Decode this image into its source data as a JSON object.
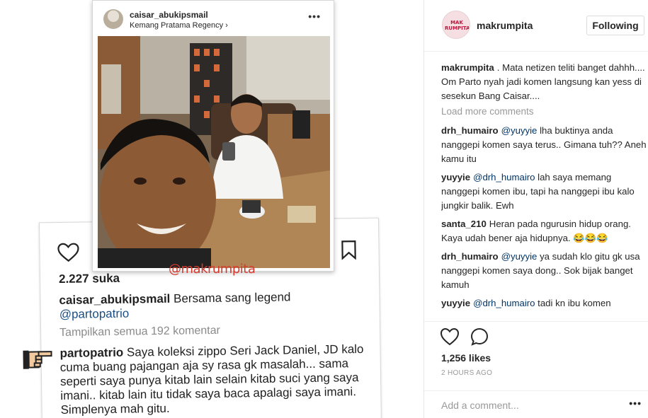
{
  "media": {
    "front": {
      "username": "caisar_abukipsmail",
      "location": "Kemang Pratama Regency",
      "more": "•••"
    },
    "watermark": "@makrumpita",
    "back": {
      "likes": "2.227 suka",
      "caption_user": "caisar_abukipsmail",
      "caption_text": "Bersama sang legend",
      "caption_mention": "@partopatrio",
      "view_all": "Tampilkan semua 192 komentar",
      "comment_user": "partopatrio",
      "comment_text": "Saya koleksi zippo Seri Jack Daniel, JD kalo cuma buang pajangan aja sy rasa gk masalah... sama seperti saya punya kitab lain selain kitab suci yang saya imani.. kitab lain itu tidak saya baca apalagi saya imani. Simplenya mah gitu."
    }
  },
  "panel": {
    "header": {
      "avatar_text": "MAK RUMPITA",
      "username": "makrumpita",
      "follow_label": "Following"
    },
    "caption": {
      "user": "makrumpita",
      "text": ". Mata netizen teliti banget dahhh.... Om Parto nyah jadi komen langsung kan yess di sesekun Bang Caisar...."
    },
    "load_more": "Load more comments",
    "comments": [
      {
        "user": "drh_humairo",
        "mention": "@yuyyie",
        "text": "lha buktinya anda nanggepi komen saya terus.. Gimana tuh?? Aneh kamu itu"
      },
      {
        "user": "yuyyie",
        "mention": "@drh_humairo",
        "text": "lah saya memang nanggepi komen ibu, tapi ha nanggepi ibu kalo jungkir balik. Ewh"
      },
      {
        "user": "santa_210",
        "mention": "",
        "text": "Heran pada ngurusin hidup orang. Kaya udah bener aja hidupnya. 😂😂😂"
      },
      {
        "user": "drh_humairo",
        "mention": "@yuyyie",
        "text": "ya sudah klo gitu gk usa nanggepi komen saya dong.. Sok bijak banget kamuh"
      },
      {
        "user": "yuyyie",
        "mention": "@drh_humairo",
        "text": "tadi kn ibu komen"
      }
    ],
    "likes": "1,256 likes",
    "time": "2 HOURS AGO",
    "add_comment_placeholder": "Add a comment...",
    "add_more": "•••"
  }
}
